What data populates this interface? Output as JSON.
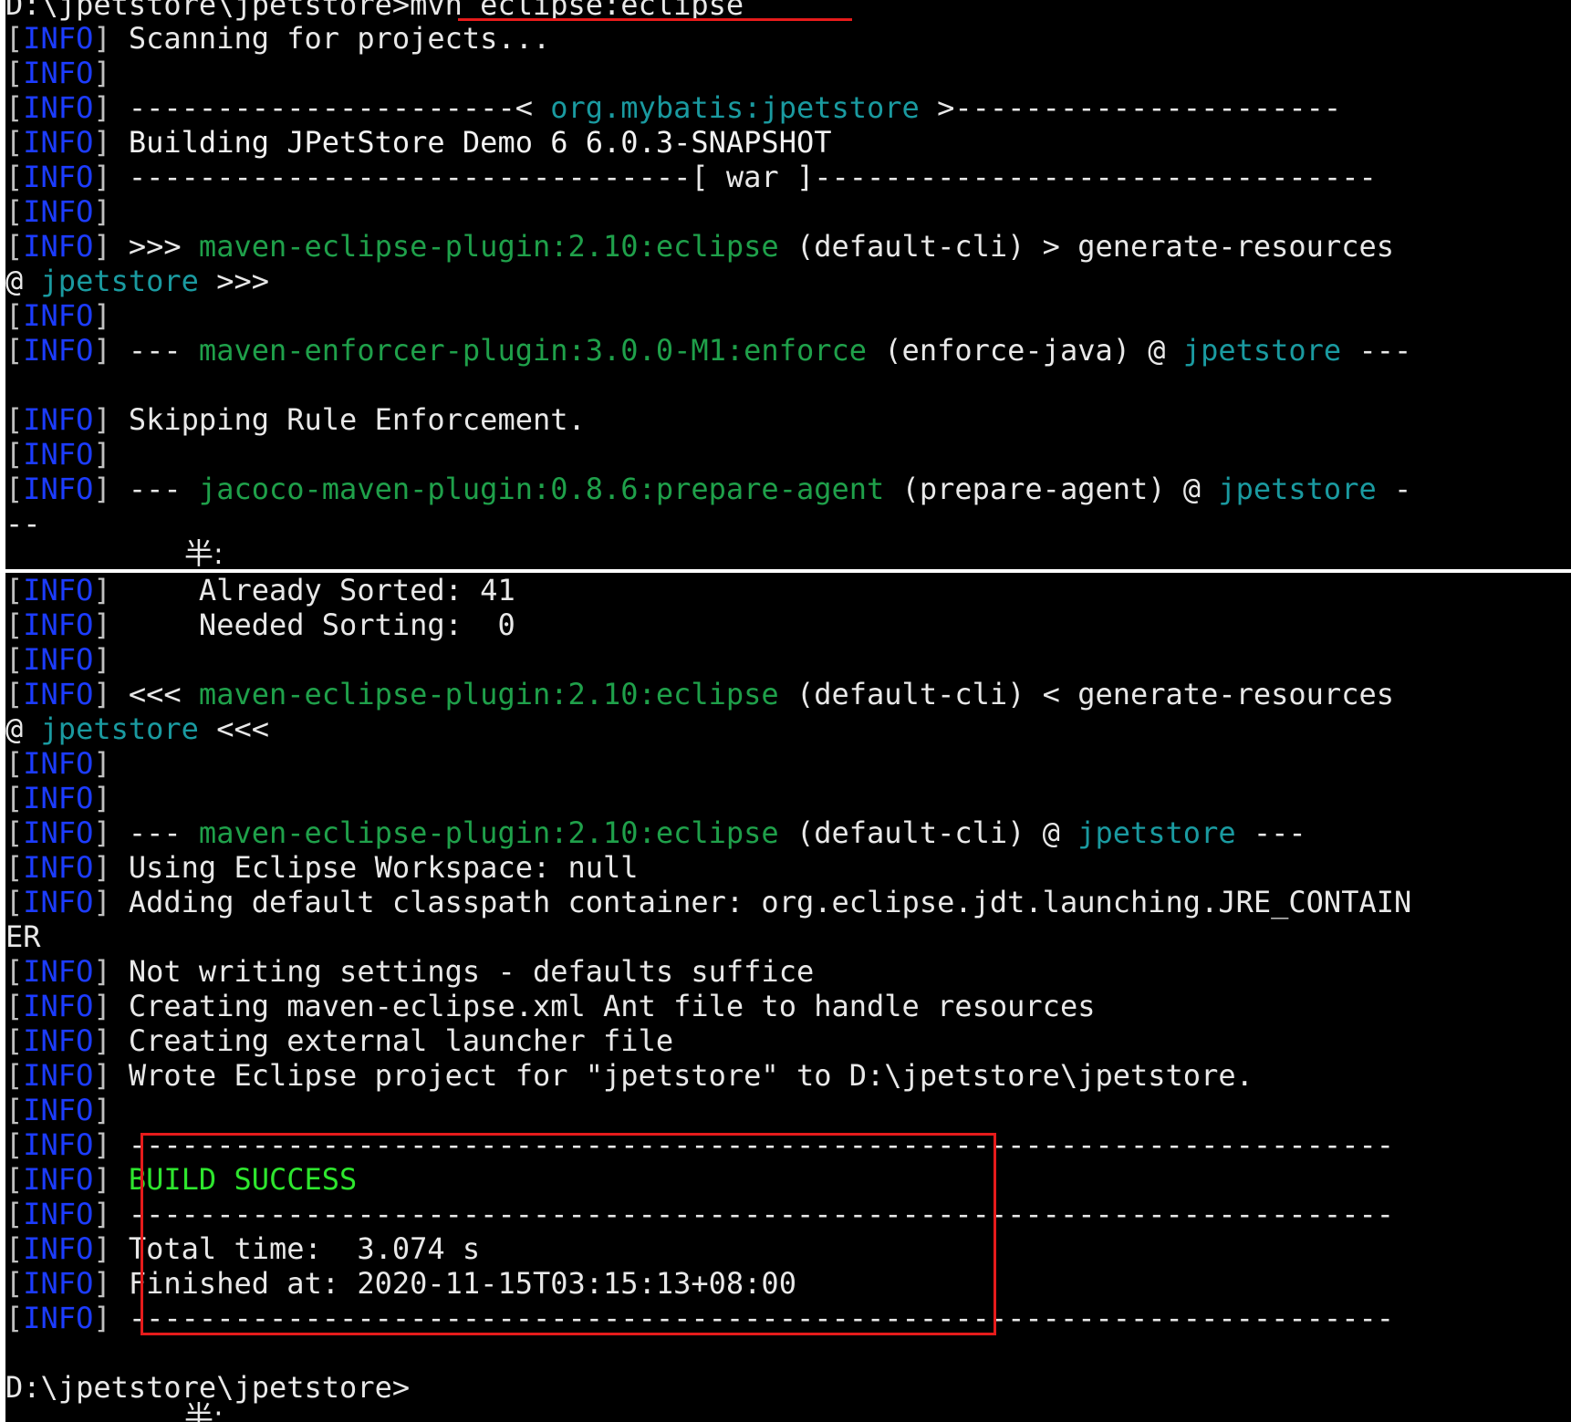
{
  "prompt_path": "D:\\jpetstore\\jpetstore>",
  "command": "mvn eclipse:eclipse",
  "info_tag": "INFO",
  "bracket_open": "[",
  "bracket_close": "]",
  "ime_top": "半:",
  "ime_bottom": "半:",
  "top": {
    "scanning": "Scanning for projects...",
    "proj_left": "----------------------< ",
    "proj_id": "org.mybatis:jpetstore",
    "proj_right": " >----------------------",
    "building": "Building JPetStore Demo 6 6.0.3-SNAPSHOT",
    "war_line": "--------------------------------[ war ]--------------------------------",
    "exec1_prefix": ">>> ",
    "exec1_plugin": "maven-eclipse-plugin:2.10:eclipse",
    "exec1_rest": " (default-cli) > generate-resources",
    "exec1_wrap_at": "@ ",
    "exec1_wrap_proj": "jpetstore",
    "exec1_wrap_end": " >>>",
    "enf_prefix": "--- ",
    "enf_plugin": "maven-enforcer-plugin:3.0.0-M1:enforce",
    "enf_mid": " (enforce-java) @ ",
    "enf_proj": "jpetstore",
    "enf_end": " ---",
    "skipping": "Skipping Rule Enforcement.",
    "jac_prefix": "--- ",
    "jac_plugin": "jacoco-maven-plugin:0.8.6:prepare-agent",
    "jac_mid": " (prepare-agent) @ ",
    "jac_proj": "jpetstore",
    "jac_end": " -",
    "jac_wrap": "--"
  },
  "bottom": {
    "already_sorted": "     Already Sorted: 41",
    "needed_sorting": "     Needed Sorting:  0",
    "exec2_prefix": "<<< ",
    "exec2_plugin": "maven-eclipse-plugin:2.10:eclipse",
    "exec2_rest": " (default-cli) < generate-resources",
    "exec2_wrap_at": "@ ",
    "exec2_wrap_proj": "jpetstore",
    "exec2_wrap_end": " <<<",
    "ecl_prefix": "--- ",
    "ecl_plugin": "maven-eclipse-plugin:2.10:eclipse",
    "ecl_mid": " (default-cli) @ ",
    "ecl_proj": "jpetstore",
    "ecl_end": " ---",
    "workspace": "Using Eclipse Workspace: null",
    "classpath": "Adding default classpath container: org.eclipse.jdt.launching.JRE_CONTAIN",
    "classpath_wrap": "ER",
    "not_writing": "Not writing settings - defaults suffice",
    "creating_xml": "Creating maven-eclipse.xml Ant file to handle resources",
    "creating_launcher": "Creating external launcher file",
    "wrote_project": "Wrote Eclipse project for \"jpetstore\" to D:\\jpetstore\\jpetstore.",
    "separator": "------------------------------------------------------------------------",
    "build_success": "BUILD SUCCESS",
    "total_time": "Total time:  3.074 s",
    "finished_at": "Finished at: 2020-11-15T03:15:13+08:00",
    "final_prompt": "D:\\jpetstore\\jpetstore>"
  },
  "colors": {
    "background": "#000000",
    "info_tag": "#1c3cff",
    "plugin_green": "#1fa04a",
    "project_cyan": "#1a9aa0",
    "success_green": "#2ee62e",
    "annotation_red": "#e61b1b"
  }
}
